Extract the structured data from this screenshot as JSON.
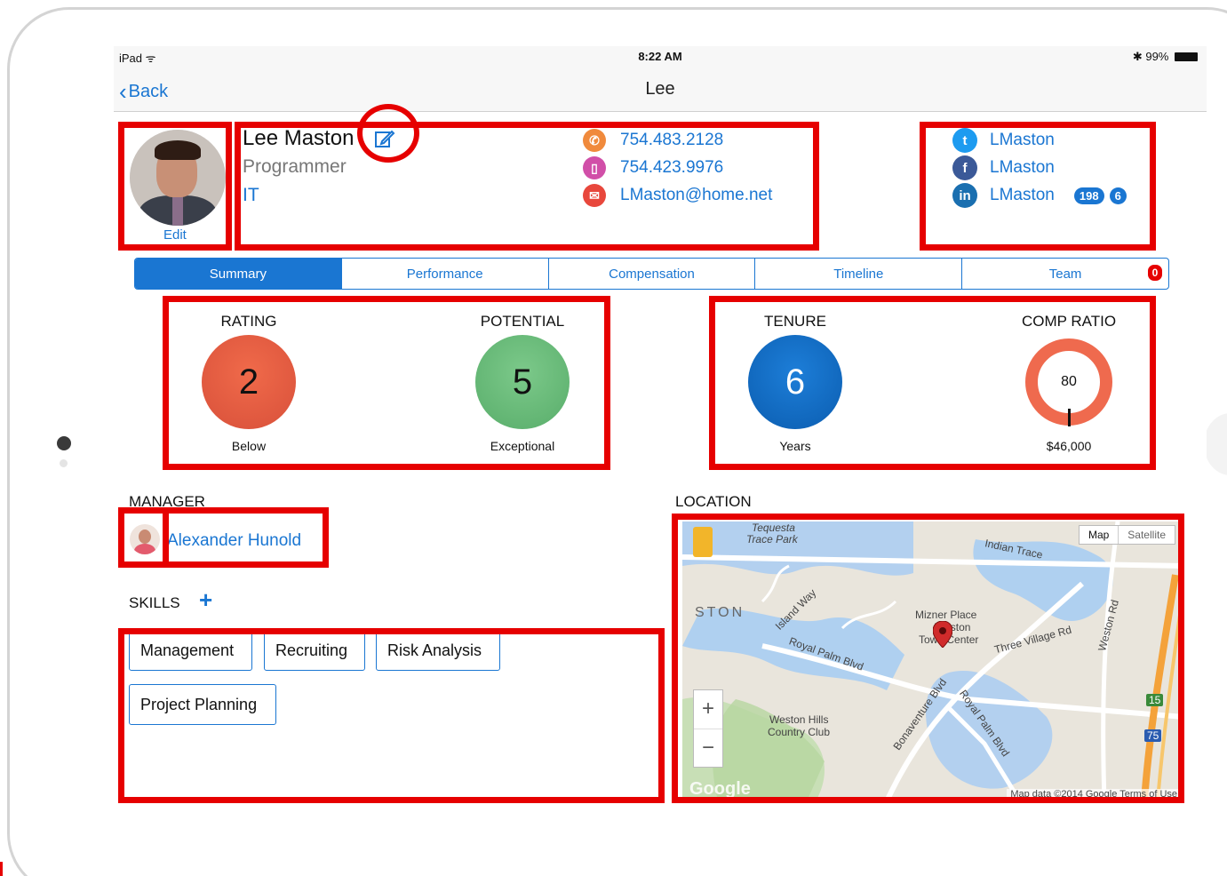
{
  "status": {
    "device": "iPad",
    "wifi": "ᯤ",
    "time": "8:22 AM",
    "bluetooth": "✱",
    "battery": "99%"
  },
  "nav": {
    "back": "Back",
    "title": "Lee"
  },
  "profile": {
    "edit": "Edit",
    "name": "Lee Maston",
    "title": "Programmer",
    "department": "IT",
    "phone": "754.483.2128",
    "mobile": "754.423.9976",
    "email": "LMaston@home.net"
  },
  "social": {
    "twitter": "LMaston",
    "facebook": "LMaston",
    "linkedin": "LMaston",
    "linkedin_connections": "198",
    "linkedin_count": "6"
  },
  "tabs": [
    "Summary",
    "Performance",
    "Compensation",
    "Timeline",
    "Team"
  ],
  "team_badge": "0",
  "metrics": {
    "rating": {
      "label": "RATING",
      "value": "2",
      "sub": "Below"
    },
    "potential": {
      "label": "POTENTIAL",
      "value": "5",
      "sub": "Exceptional"
    },
    "tenure": {
      "label": "TENURE",
      "value": "6",
      "sub": "Years"
    },
    "comp_ratio": {
      "label": "COMP RATIO",
      "value": "80",
      "sub": "$46,000"
    }
  },
  "manager": {
    "label": "MANAGER",
    "name": "Alexander Hunold"
  },
  "skills": {
    "label": "SKILLS",
    "items": [
      "Management",
      "Recruiting",
      "Risk Analysis",
      "Project Planning"
    ]
  },
  "location": {
    "label": "LOCATION",
    "map_button": "Map",
    "satellite_button": "Satellite",
    "zoom_in": "+",
    "zoom_out": "−",
    "labels": [
      "Tequesta",
      "Trace Park",
      "Indian Trace",
      "STON",
      "Island Way",
      "Mizner Place",
      "Weston",
      "Town Center",
      "Three Village Rd",
      "Weston Rd",
      "Royal Palm Blvd",
      "Bonaventure Blvd",
      "Royal Palm Blvd",
      "Weston Hills",
      "Country Club",
      "15",
      "75"
    ],
    "footer": "Map data ©2014 Google   Terms of Use",
    "google": "Google"
  },
  "colors": {
    "accent": "#1a76d2",
    "annotation": "#e60000",
    "rating": "#e0573d",
    "potential": "#6bbd7a",
    "tenure": "#0f6cc4",
    "comp": "#ef6a4e"
  }
}
